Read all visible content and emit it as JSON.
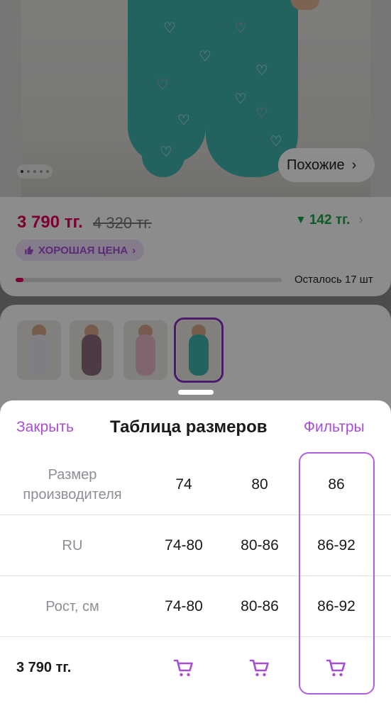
{
  "product": {
    "similar_label": "Похожие",
    "price_now": "3 790 тг.",
    "price_old": "4 320 тг.",
    "price_diff": "142 тг.",
    "good_price_badge": "ХОРОШАЯ ЦЕНА",
    "stock_text": "Осталось 17 шт",
    "stock_fraction": 0.03,
    "photo_dots": {
      "count": 5,
      "active": 1
    },
    "variants": [
      {
        "color": "#e9e6ee",
        "selected": false
      },
      {
        "color": "#8a6a7c",
        "selected": false
      },
      {
        "color": "#e8b9c8",
        "selected": false
      },
      {
        "color": "#3fb3ae",
        "selected": true
      }
    ]
  },
  "sheet": {
    "close_label": "Закрыть",
    "title": "Таблица размеров",
    "filters_label": "Фильтры",
    "rows": [
      {
        "label": "Размер производителя",
        "values": [
          "74",
          "80",
          "86"
        ]
      },
      {
        "label": "RU",
        "values": [
          "74-80",
          "80-86",
          "86-92"
        ]
      },
      {
        "label": "Рост, см",
        "values": [
          "74-80",
          "80-86",
          "86-92"
        ]
      }
    ],
    "price_row": {
      "label": "3 790 тг.",
      "icon": "cart-icon"
    },
    "highlighted_column": 3
  },
  "colors": {
    "accent": "#a64fd6",
    "price": "#e4005c",
    "discount": "#1aa34a",
    "highlight_border": "#b25ee0"
  }
}
